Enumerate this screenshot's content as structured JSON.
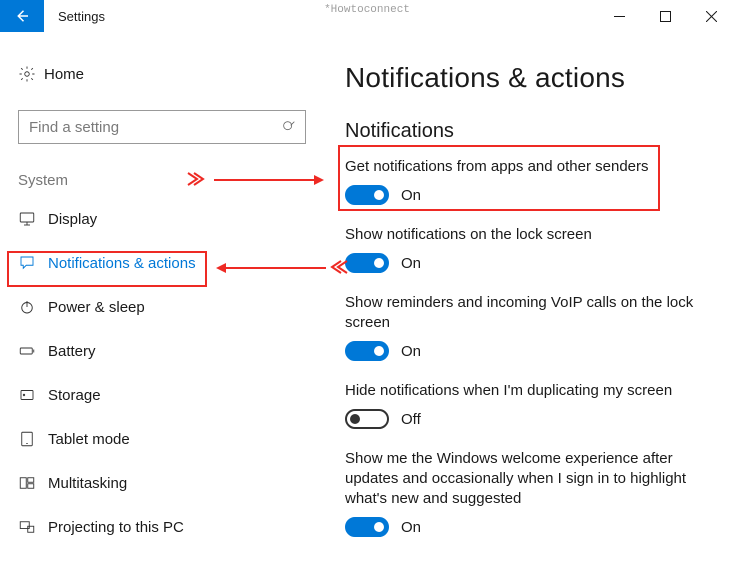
{
  "watermark": "*Howtoconnect",
  "titlebar": {
    "title": "Settings"
  },
  "home": {
    "label": "Home"
  },
  "search": {
    "placeholder": "Find a setting"
  },
  "sidebar": {
    "section_label": "System",
    "items": [
      {
        "label": "Display"
      },
      {
        "label": "Notifications & actions"
      },
      {
        "label": "Power & sleep"
      },
      {
        "label": "Battery"
      },
      {
        "label": "Storage"
      },
      {
        "label": "Tablet mode"
      },
      {
        "label": "Multitasking"
      },
      {
        "label": "Projecting to this PC"
      }
    ]
  },
  "page": {
    "title": "Notifications & actions",
    "subhead": "Notifications",
    "settings": [
      {
        "label": "Get notifications from apps and other senders",
        "on": true,
        "state": "On"
      },
      {
        "label": "Show notifications on the lock screen",
        "on": true,
        "state": "On"
      },
      {
        "label": "Show reminders and incoming VoIP calls on the lock screen",
        "on": true,
        "state": "On"
      },
      {
        "label": "Hide notifications when I'm duplicating my screen",
        "on": false,
        "state": "Off"
      },
      {
        "label": "Show me the Windows welcome experience after updates and occasionally when I sign in to highlight what's new and suggested",
        "on": true,
        "state": "On"
      }
    ]
  }
}
